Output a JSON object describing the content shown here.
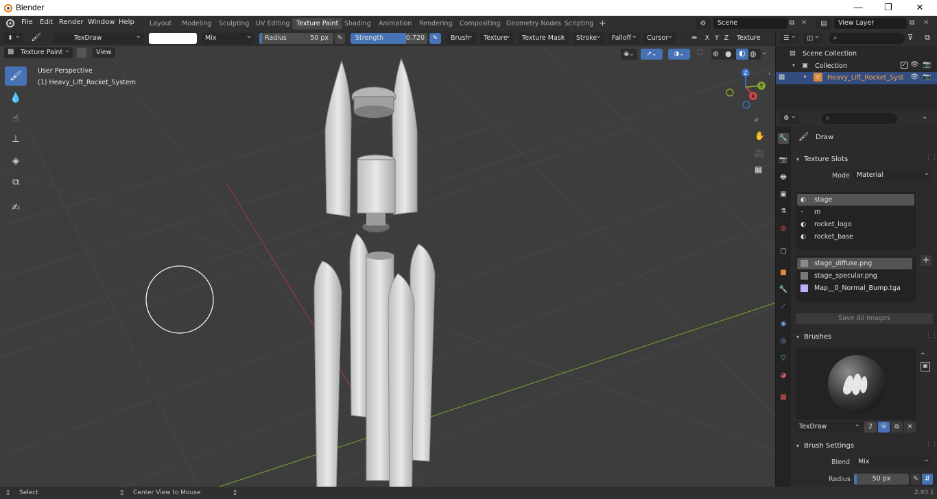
{
  "window": {
    "title": "Blender",
    "min": "—",
    "max": "❐",
    "close": "✕"
  },
  "menus": [
    "File",
    "Edit",
    "Render",
    "Window",
    "Help"
  ],
  "workspaces": [
    "Layout",
    "Modeling",
    "Sculpting",
    "UV Editing",
    "Texture Paint",
    "Shading",
    "Animation",
    "Rendering",
    "Compositing",
    "Geometry Nodes",
    "Scripting"
  ],
  "active_workspace": "Texture Paint",
  "add_workspace": "+",
  "scene": {
    "name": "Scene",
    "view_layer": "View Layer"
  },
  "tool_header": {
    "brush_name": "TexDraw",
    "blend": "Mix",
    "radius_label": "Radius",
    "radius_value": "50 px",
    "strength_label": "Strength",
    "strength_value": "0.720",
    "strength_fraction": 0.72,
    "menus": [
      "Brush",
      "Texture",
      "Texture Mask",
      "Stroke",
      "Falloff",
      "Cursor"
    ],
    "axes": [
      "X",
      "Y",
      "Z"
    ],
    "texture_slots": "Texture Slots"
  },
  "mode_header": {
    "mode": "Texture Paint",
    "view": "View"
  },
  "viewport": {
    "perspective": "User Perspective",
    "object": "(1) Heavy_Lift_Rocket_System",
    "gizmo": {
      "x": "X",
      "y": "Y",
      "z": "Z"
    },
    "colors": {
      "bg": "#3d3d3d",
      "x_axis": "#9b3a3a",
      "y_axis": "#6e9a2c",
      "select": "#4772b3"
    }
  },
  "outliner": {
    "root": "Scene Collection",
    "collection": "Collection",
    "object": "Heavy_Lift_Rocket_Syst"
  },
  "properties": {
    "brush_tab_title": "Draw",
    "texture_slots": {
      "title": "Texture Slots",
      "mode_label": "Mode",
      "mode_value": "Material",
      "materials": [
        "stage",
        "m",
        "rocket_logo",
        "rocket_base"
      ],
      "images": [
        "stage_diffuse.png",
        "stage_specular.png",
        "Map__0_Normal_Bump.tga"
      ],
      "save_all": "Save All Images",
      "add": "+"
    },
    "brushes": {
      "title": "Brushes",
      "name": "TexDraw",
      "users": "2"
    },
    "brush_settings": {
      "title": "Brush Settings",
      "blend_label": "Blend",
      "blend_value": "Mix",
      "radius_label": "Radius",
      "radius_value": "50 px"
    }
  },
  "status": {
    "select": "Select",
    "center": "Center View to Mouse",
    "version": "2.93.1"
  }
}
